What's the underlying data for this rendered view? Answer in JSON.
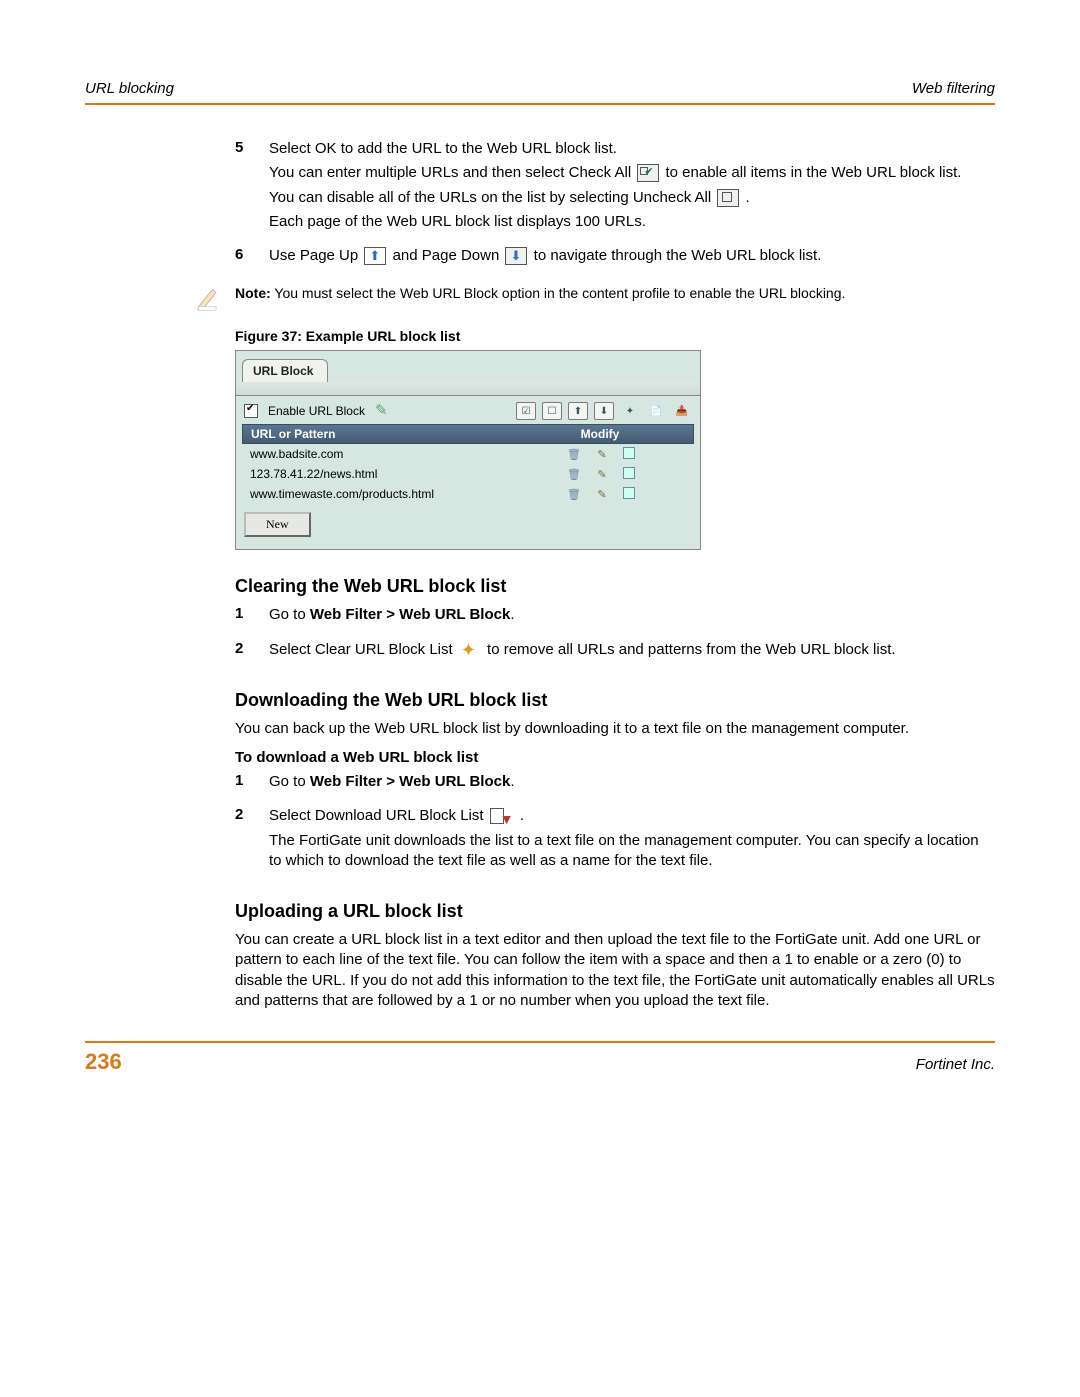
{
  "header": {
    "left": "URL blocking",
    "right": "Web filtering"
  },
  "footer": {
    "page": "236",
    "brand": "Fortinet Inc."
  },
  "steps_a": {
    "n5": "5",
    "n6": "6",
    "s5a": "Select OK to add the URL to the Web URL block list.",
    "s5b_pre": "You can enter multiple URLs and then select Check All ",
    "s5b_post": " to enable all items in the Web URL block list.",
    "s5c_pre": "You can disable all of the URLs on the list by selecting Uncheck All ",
    "s5c_post": " .",
    "s5d": "Each page of the Web URL block list displays 100 URLs.",
    "s6_pre": "Use Page Up ",
    "s6_mid": " and Page Down ",
    "s6_post": " to navigate through the Web URL block list."
  },
  "note": {
    "label": "Note:",
    "text": " You must select the Web URL Block option in the content profile to enable the URL blocking."
  },
  "figure_caption": "Figure 37: Example URL block list",
  "ui": {
    "tab": "URL Block",
    "enable_label": "Enable URL Block",
    "col_url": "URL or Pattern",
    "col_modify": "Modify",
    "rows": [
      "www.badsite.com",
      "123.78.41.22/news.html",
      "www.timewaste.com/products.html"
    ],
    "new_btn": "New"
  },
  "sections": {
    "clearing": {
      "title": "Clearing the Web URL block list",
      "n1": "1",
      "n2": "2",
      "s1_pre": "Go to ",
      "s1_bold": "Web Filter > Web URL Block",
      "s1_post": ".",
      "s2_pre": "Select Clear URL Block List ",
      "s2_post": " to remove all URLs and patterns from the Web URL block list."
    },
    "downloading": {
      "title": "Downloading the Web URL block list",
      "intro": "You can back up the Web URL block list by downloading it to a text file on the management computer.",
      "subhead": "To download a Web URL block list",
      "n1": "1",
      "n2": "2",
      "s1_pre": "Go to ",
      "s1_bold": "Web Filter > Web URL Block",
      "s1_post": ".",
      "s2_pre": "Select Download URL Block List ",
      "s2_post": " .",
      "s2_p2": "The FortiGate unit downloads the list to a text file on the management computer. You can specify a location to which to download the text file as well as a name for the text file."
    },
    "uploading": {
      "title": "Uploading a URL block list",
      "body": "You can create a URL block list in a text editor and then upload the text file to the FortiGate unit. Add one URL or pattern to each line of the text file. You can follow the item with a space and then a 1 to enable or a zero (0) to disable the URL. If you do not add this information to the text file, the FortiGate unit automatically enables all URLs and patterns that are followed by a 1 or no number when you upload the text file."
    }
  }
}
